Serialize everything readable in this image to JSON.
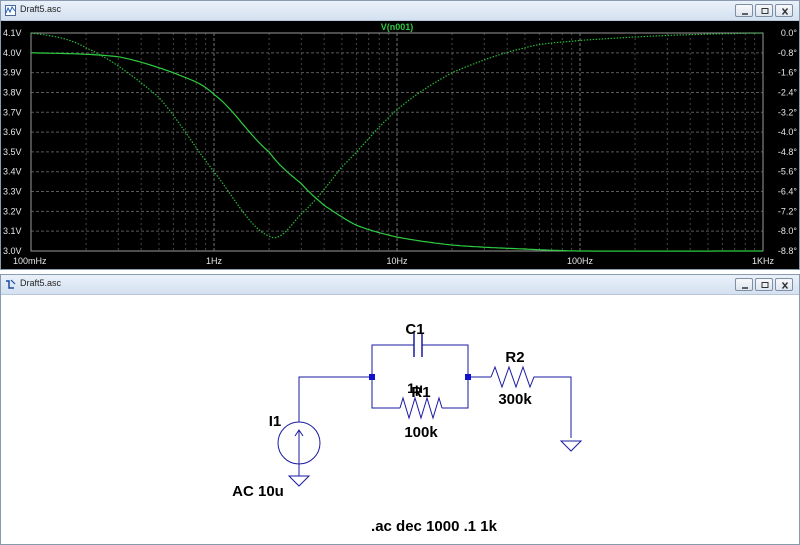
{
  "plot_window": {
    "title": "Draft5.asc",
    "trace_label": "V(n001)"
  },
  "schematic_window": {
    "title": "Draft5.asc",
    "components": {
      "C1": {
        "name": "C1",
        "value": "1µ"
      },
      "R1": {
        "name": "R1",
        "value": "100k"
      },
      "R2": {
        "name": "R2",
        "value": "300k"
      },
      "I1": {
        "name": "I1",
        "value": "AC 10u"
      }
    },
    "directive": ".ac dec 1000 .1 1k"
  },
  "chart_data": {
    "type": "line",
    "title": "V(n001)",
    "x_scale": "log",
    "xlim": [
      0.1,
      1000
    ],
    "x_ticks": [
      "100mHz",
      "1Hz",
      "10Hz",
      "100Hz",
      "1KHz"
    ],
    "y_left_ticks": [
      "4.1V",
      "4.0V",
      "3.9V",
      "3.8V",
      "3.7V",
      "3.6V",
      "3.5V",
      "3.4V",
      "3.3V",
      "3.2V",
      "3.1V",
      "3.0V"
    ],
    "y_right_ticks": [
      "0.0°",
      "-0.8°",
      "-1.6°",
      "-2.4°",
      "-3.2°",
      "-4.0°",
      "-4.8°",
      "-5.6°",
      "-6.4°",
      "-7.2°",
      "-8.0°",
      "-8.8°"
    ],
    "ylim_left": [
      3.0,
      4.1
    ],
    "ylim_right": [
      -8.8,
      0.0
    ],
    "grid": true,
    "series": [
      {
        "axis": "left",
        "style": "solid",
        "color": "#2ecc40",
        "x": [
          0.1,
          0.3,
          0.6,
          1,
          2,
          3,
          4,
          6,
          10,
          20,
          50,
          100,
          1000
        ],
        "y": [
          4.0,
          3.98,
          3.9,
          3.79,
          3.5,
          3.34,
          3.23,
          3.13,
          3.07,
          3.03,
          3.01,
          3.0,
          3.0
        ]
      },
      {
        "axis": "right",
        "style": "dotted",
        "color": "#2ecc40",
        "x": [
          0.1,
          0.2,
          0.5,
          1,
          2,
          3,
          5,
          10,
          20,
          50,
          100,
          300,
          1000
        ],
        "y": [
          0.0,
          -0.6,
          -2.6,
          -5.6,
          -8.2,
          -7.3,
          -5.4,
          -3.1,
          -1.6,
          -0.6,
          -0.3,
          -0.1,
          0.0
        ]
      }
    ]
  },
  "colors": {
    "plot_bg": "#000000",
    "grid": "#808080",
    "trace": "#2ecc40",
    "wire": "#1a1aa0",
    "node": "#1111cc"
  }
}
